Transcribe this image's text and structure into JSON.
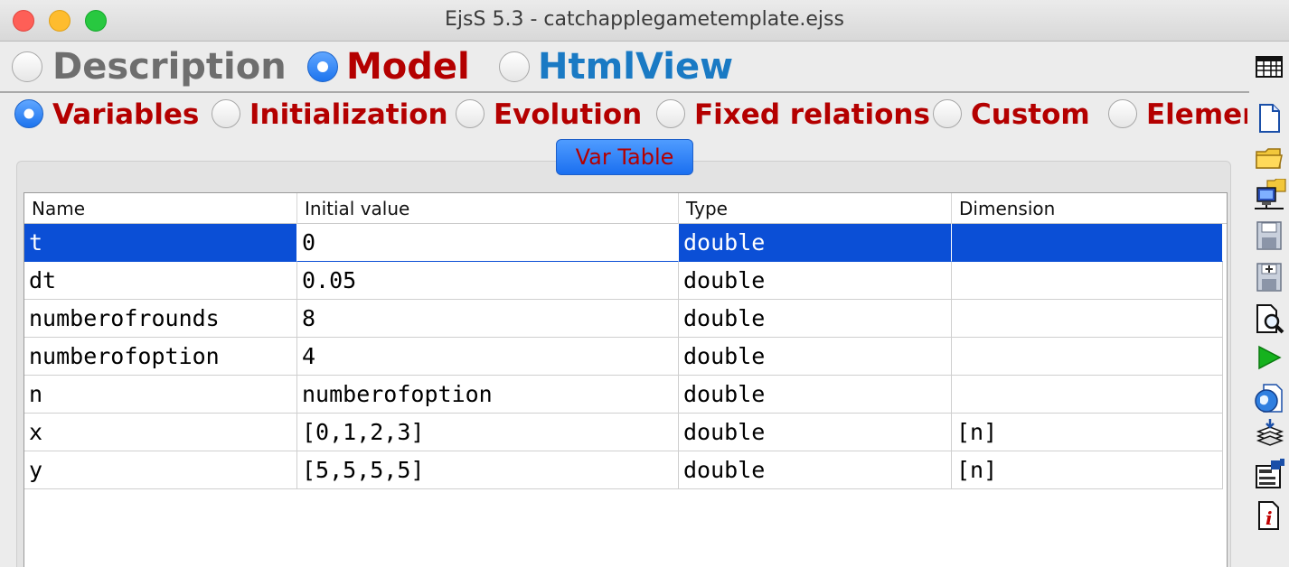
{
  "window": {
    "title": "EjsS 5.3 - catchapplegametemplate.ejss"
  },
  "top_tabs": [
    {
      "label": "Description",
      "selected": false,
      "color": "#6e6e6e"
    },
    {
      "label": "Model",
      "selected": true,
      "color": "#b40000"
    },
    {
      "label": "HtmlView",
      "selected": false,
      "color": "#1a7ac4"
    }
  ],
  "sub_tabs": [
    {
      "label": "Variables",
      "selected": true
    },
    {
      "label": "Initialization",
      "selected": false
    },
    {
      "label": "Evolution",
      "selected": false
    },
    {
      "label": "Fixed relations",
      "selected": false
    },
    {
      "label": "Custom",
      "selected": false
    },
    {
      "label": "Elemer",
      "selected": false
    }
  ],
  "panel": {
    "button_label": "Var Table"
  },
  "table": {
    "columns": [
      "Name",
      "Initial value",
      "Type",
      "Dimension"
    ],
    "rows": [
      {
        "name": "t",
        "initial": "0",
        "type": "double",
        "dimension": "",
        "selected": true
      },
      {
        "name": "dt",
        "initial": "0.05",
        "type": "double",
        "dimension": ""
      },
      {
        "name": "numberofrounds",
        "initial": "8",
        "type": "double",
        "dimension": ""
      },
      {
        "name": "numberofoption",
        "initial": "4",
        "type": "double",
        "dimension": ""
      },
      {
        "name": "n",
        "initial": "numberofoption",
        "type": "double",
        "dimension": ""
      },
      {
        "name": "x",
        "initial": "[0,1,2,3]",
        "type": "double",
        "dimension": "[n]"
      },
      {
        "name": "y",
        "initial": "[5,5,5,5]",
        "type": "double",
        "dimension": "[n]"
      }
    ]
  },
  "toolbar_icons": [
    "table-view-icon",
    "new-file-icon",
    "open-folder-icon",
    "open-network-icon",
    "save-icon",
    "save-as-icon",
    "search-icon",
    "run-icon",
    "web-icon",
    "package-icon",
    "options-icon",
    "info-icon"
  ]
}
